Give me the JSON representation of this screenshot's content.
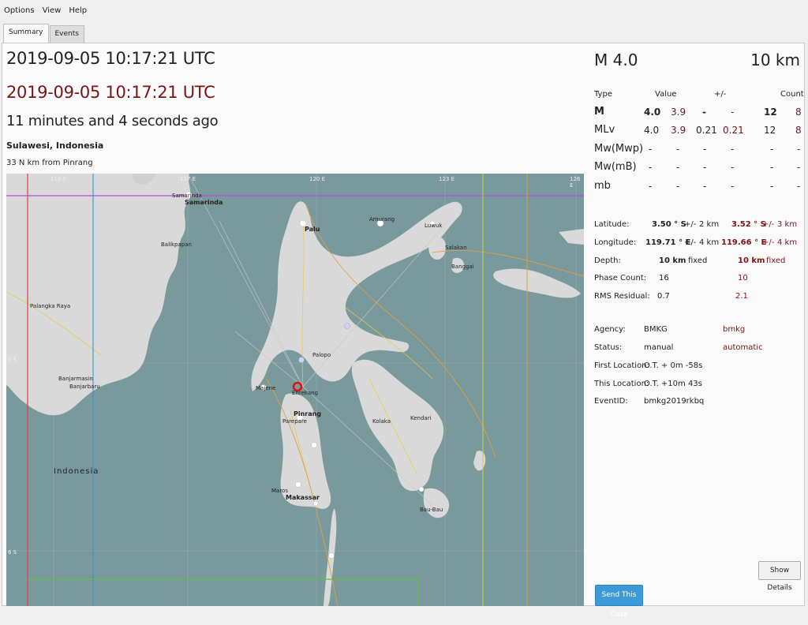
{
  "menu": [
    "Options",
    "View",
    "Help"
  ],
  "tabs": [
    "Summary",
    "Events"
  ],
  "event": {
    "time_utc": "2019-09-05 10:17:21 UTC",
    "time_utc_auto": "2019-09-05 10:17:21 UTC",
    "ago": "11 minutes and 4 seconds ago",
    "region": "Sulawesi, Indonesia",
    "nearby": "33 N km from Pinrang"
  },
  "summary": {
    "mag": "M 4.0",
    "depth": "10 km"
  },
  "mag_table": {
    "headers": {
      "type": "Type",
      "value": "Value",
      "pm": "+/-",
      "count": "Count"
    },
    "rows": [
      {
        "type": "M",
        "v1": "4.0",
        "v2": "3.9",
        "e1": "-",
        "e2": "-",
        "c1": "12",
        "c2": "8"
      },
      {
        "type": "MLv",
        "v1": "4.0",
        "v2": "3.9",
        "e1": "0.21",
        "e2": "0.21",
        "c1": "12",
        "c2": "8"
      },
      {
        "type": "Mw(Mwp)",
        "v1": "-",
        "v2": "-",
        "e1": "-",
        "e2": "-",
        "c1": "-",
        "c2": "-"
      },
      {
        "type": "Mw(mB)",
        "v1": "-",
        "v2": "-",
        "e1": "-",
        "e2": "-",
        "c1": "-",
        "c2": "-"
      },
      {
        "type": "mb",
        "v1": "-",
        "v2": "-",
        "e1": "-",
        "e2": "-",
        "c1": "-",
        "c2": "-"
      }
    ]
  },
  "location": {
    "latitude_label": "Latitude:",
    "latitude": "3.50 ° S",
    "latitude_pm": "+/-",
    "latitude_err": "2 km",
    "latitude_auto": "3.52 ° S",
    "latitude_auto_pm": "+/-",
    "latitude_auto_err": "3 km",
    "longitude_label": "Longitude:",
    "longitude": "119.71 ° E",
    "longitude_pm": "+/-",
    "longitude_err": "4 km",
    "longitude_auto": "119.66 ° E",
    "longitude_auto_pm": "+/-",
    "longitude_auto_err": "4 km",
    "depth_label": "Depth:",
    "depth": "10 km",
    "depth_type": "fixed",
    "depth_auto": "10 km",
    "depth_auto_type": "fixed",
    "phase_label": "Phase Count:",
    "phase": "16",
    "phase_auto": "10",
    "rms_label": "RMS Residual:",
    "rms": "0.7",
    "rms_auto": "2.1"
  },
  "info": {
    "agency_label": "Agency:",
    "agency": "BMKG",
    "agency_auto": "bmkg",
    "status_label": "Status:",
    "status": "manual",
    "status_auto": "automatic",
    "first_label": "First Location:",
    "first": "O.T. + 0m -58s",
    "this_label": "This Location:",
    "this": "O.T. +10m 43s",
    "eventid_label": "EventID:",
    "eventid": "bmkg2019rkbq"
  },
  "buttons": {
    "details": "Show Details",
    "send": "Send This Data"
  },
  "map": {
    "ticks_x": [
      "114 E",
      "117 E",
      "120 E",
      "123 E",
      "126 E"
    ],
    "ticks_y": [
      "3 S",
      "6 S"
    ],
    "labels": [
      "Samarinda",
      "Palu",
      "Amurang",
      "Luwuk",
      "Salakan",
      "Banggai",
      "Balikpapan",
      "Palangka Raya",
      "Banjarmasin",
      "Banjarbaru",
      "Palopo",
      "Enrekang",
      "Pinrang",
      "Parepare",
      "Majene",
      "Kolaka",
      "Kendari",
      "Makassar",
      "Maros",
      "Bau-Bau",
      "Indonesia"
    ],
    "colors": {
      "sea": "#7a999d",
      "land": "#d9d9d9",
      "epicenter": "#e01010"
    }
  }
}
